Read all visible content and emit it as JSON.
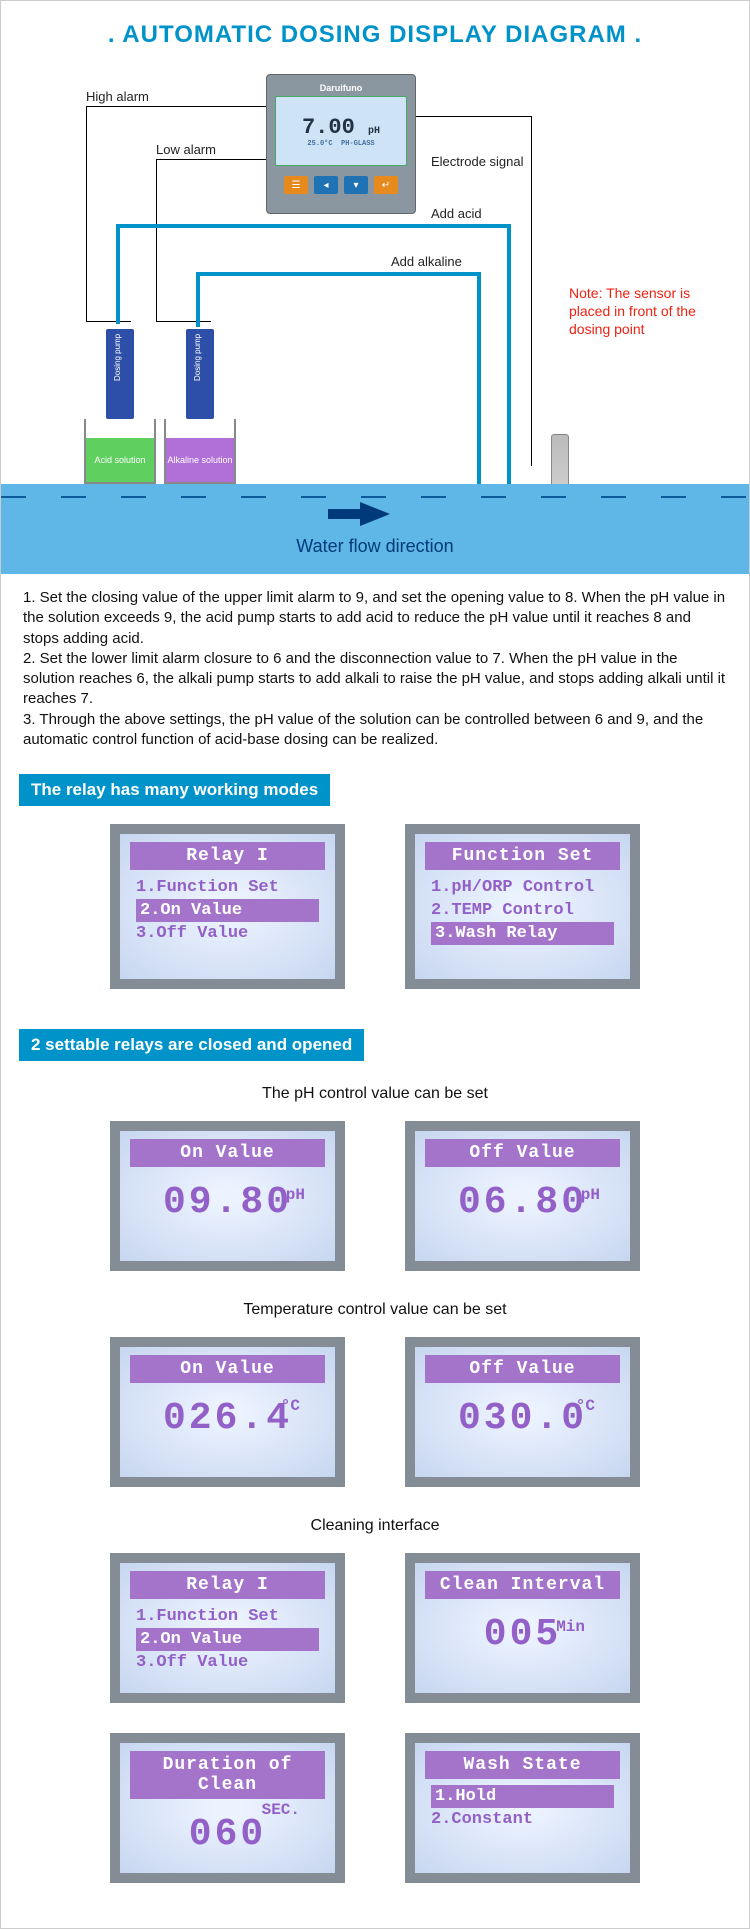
{
  "title": ". AUTOMATIC DOSING DISPLAY DIAGRAM .",
  "controller": {
    "brand": "Daruifuno",
    "reading_value": "7.00",
    "reading_unit": "pH",
    "temp": "25.0°C",
    "probe": "PH-GLASS"
  },
  "labels": {
    "high_alarm": "High alarm",
    "low_alarm": "Low alarm",
    "electrode_signal": "Electrode signal",
    "add_acid": "Add acid",
    "add_alkaline": "Add alkaline",
    "dosing_pump": "Dosing pump",
    "acid_solution": "Acid solution",
    "alkaline_solution": "Alkaline solution",
    "water_flow": "Water flow direction"
  },
  "note": "Note: The sensor is placed in front of the dosing point",
  "instructions": [
    "1. Set the closing value of the upper limit alarm to 9, and set the opening value to 8. When the pH value in the solution exceeds 9, the acid pump starts to add acid to reduce the pH value until it reaches 8 and stops adding acid.",
    "2. Set the lower limit alarm closure to 6 and the disconnection value to 7. When the pH value in the solution reaches 6, the alkali pump starts to add alkali to raise the pH value, and stops adding alkali until it reaches 7.",
    "3. Through the above settings, the pH value of the solution can be controlled between 6 and 9, and the automatic control function of acid-base dosing can be realized."
  ],
  "section_relay_modes": "The relay has many working modes",
  "section_relay_settable": "2 settable relays are closed and opened",
  "subcaptions": {
    "ph_set": "The pH control value can be set",
    "temp_set": "Temperature control value can be set",
    "clean": "Cleaning interface"
  },
  "lcd": {
    "relay1": {
      "title": "Relay I",
      "items": [
        "1.Function Set",
        "2.On Value",
        "3.Off Value"
      ],
      "selected": 1
    },
    "function_set": {
      "title": "Function Set",
      "items": [
        "1.pH/ORP Control",
        "2.TEMP Control",
        "3.Wash Relay"
      ],
      "selected": 2
    },
    "on_ph": {
      "title": "On Value",
      "value": "09.80",
      "unit": "pH"
    },
    "off_ph": {
      "title": "Off Value",
      "value": "06.80",
      "unit": "pH"
    },
    "on_tc": {
      "title": "On Value",
      "value": "026.4",
      "unit": "°C"
    },
    "off_tc": {
      "title": "Off Value",
      "value": "030.0",
      "unit": "°C"
    },
    "relay1b": {
      "title": "Relay I",
      "items": [
        "1.Function Set",
        "2.On Value",
        "3.Off Value"
      ],
      "selected": 1
    },
    "clean_interval": {
      "title": "Clean Interval",
      "value": "005",
      "unit": "Min"
    },
    "clean_duration": {
      "title": "Duration of Clean",
      "value": "060",
      "unit": "SEC."
    },
    "wash_state": {
      "title": "Wash State",
      "items": [
        "1.Hold",
        "2.Constant"
      ],
      "selected": 0
    }
  }
}
